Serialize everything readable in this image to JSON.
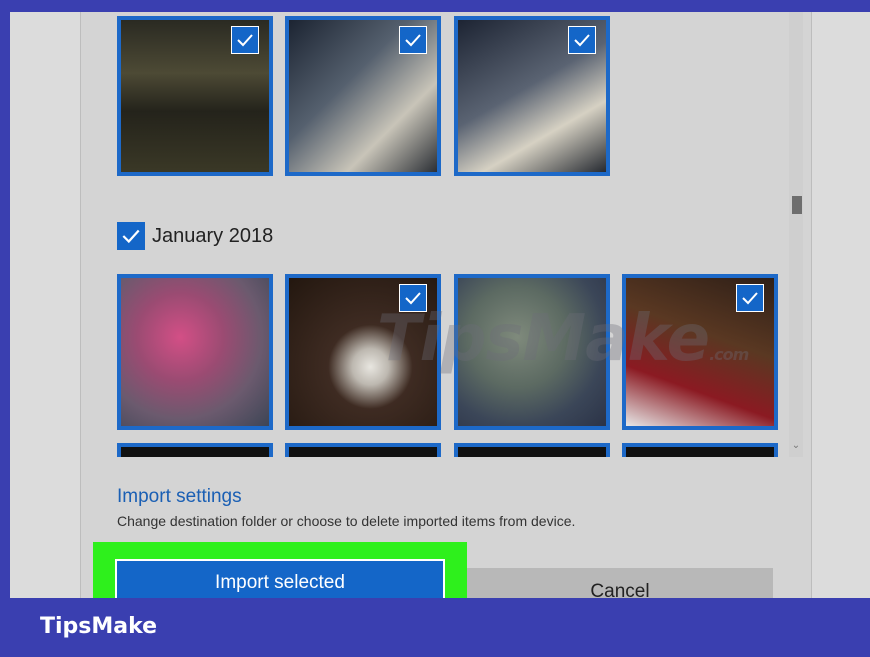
{
  "date_group": {
    "label": "January 2018"
  },
  "import_settings": {
    "link_label": "Import settings",
    "description": "Change destination folder or choose to delete imported items from device."
  },
  "buttons": {
    "import_selected": "Import selected",
    "cancel": "Cancel"
  },
  "watermark": {
    "text": "TipsMake",
    "suffix": ".com"
  },
  "footer": {
    "brand": "TipsMake"
  },
  "photos": {
    "row1": [
      {
        "selected": true
      },
      {
        "selected": true
      },
      {
        "selected": true
      }
    ],
    "row2": [
      {
        "selected": false
      },
      {
        "selected": true
      },
      {
        "selected": false
      },
      {
        "selected": true
      }
    ]
  },
  "colors": {
    "accent": "#1466c8",
    "highlight": "#2ef01c",
    "band": "#3a3fb0"
  },
  "icons": {
    "check": "check-icon",
    "scroll_down": "chevron-down-icon"
  }
}
